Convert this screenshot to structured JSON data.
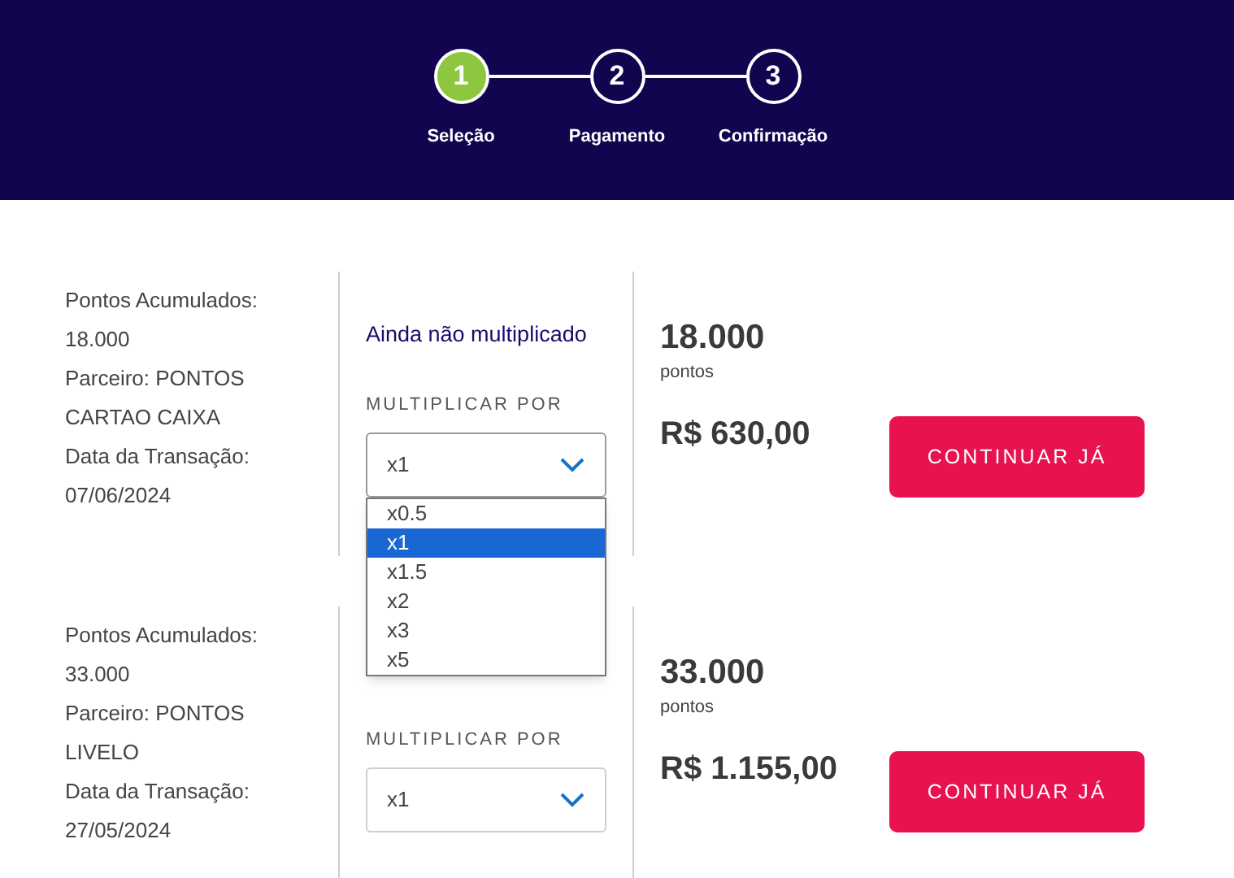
{
  "stepper": {
    "steps": [
      {
        "number": "1",
        "label": "Seleção",
        "selected": true
      },
      {
        "number": "2",
        "label": "Pagamento",
        "selected": false
      },
      {
        "number": "3",
        "label": "Confirmação",
        "selected": false
      }
    ]
  },
  "offers": [
    {
      "details": [
        "Pontos Acumulados:",
        "18.000",
        "Parceiro: PONTOS",
        "CARTAO CAIXA",
        "Data da Transação:",
        "07/06/2024"
      ],
      "status": "Ainda não multiplicado",
      "multiplier_label": "MULTIPLICAR POR",
      "multiplier": {
        "value": "x1",
        "expanded": true,
        "options": [
          {
            "label": "x0.5",
            "selected": false
          },
          {
            "label": "x1",
            "selected": true
          },
          {
            "label": "x1.5",
            "selected": false
          },
          {
            "label": "x2",
            "selected": false
          },
          {
            "label": "x3",
            "selected": false
          },
          {
            "label": "x5",
            "selected": false
          }
        ]
      },
      "points": "18.000",
      "points_unit": "pontos",
      "price": "R$ 630,00",
      "button": "CONTINUAR JÁ"
    },
    {
      "details": [
        "Pontos Acumulados:",
        "33.000",
        "Parceiro: PONTOS",
        "LIVELO",
        "Data da Transação:",
        "27/05/2024"
      ],
      "multiplier_label": "MULTIPLICAR POR",
      "multiplier": {
        "value": "x1",
        "expanded": false
      },
      "points": "33.000",
      "points_unit": "pontos",
      "price": "R$ 1.155,00",
      "button": "CONTINUAR JÁ"
    }
  ]
}
